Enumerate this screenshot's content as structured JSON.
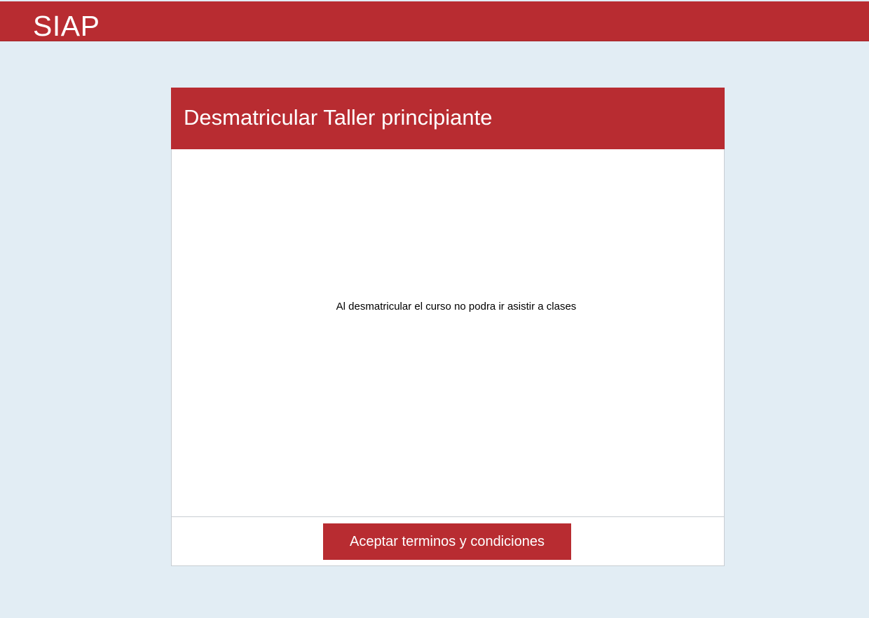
{
  "header": {
    "app_title": "SIAP"
  },
  "dialog": {
    "title": "Desmatricular Taller principiante",
    "message": "Al desmatricular el curso no podra ir asistir a clases",
    "accept_label": "Aceptar terminos y condiciones"
  },
  "colors": {
    "brand": "#b82c31",
    "background": "#e2edf4",
    "surface": "#ffffff"
  }
}
